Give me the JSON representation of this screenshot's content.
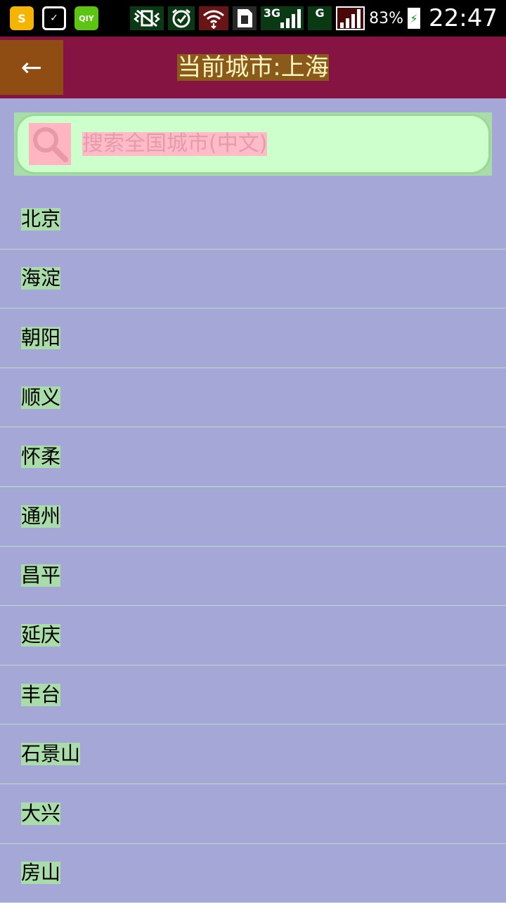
{
  "status_bar": {
    "apps": [
      {
        "name": "sogou-app-icon",
        "glyph": "S"
      },
      {
        "name": "notification-app-icon",
        "glyph": "✓"
      },
      {
        "name": "iqiyi-app-icon",
        "glyph": "QIY"
      }
    ],
    "network_3g": "3G",
    "network_g": "G",
    "battery_percent": "83%",
    "time": "22:47"
  },
  "header": {
    "back_glyph": "←",
    "title": "当前城市:上海"
  },
  "search": {
    "placeholder": "搜索全国城市(中文)"
  },
  "cities": [
    "北京",
    "海淀",
    "朝阳",
    "顺义",
    "怀柔",
    "通州",
    "昌平",
    "延庆",
    "丰台",
    "石景山",
    "大兴",
    "房山"
  ],
  "colors": {
    "title_bar": "#851442",
    "back_button": "#8f4d13",
    "background": "#a5a8d6",
    "search_box": "#ccffcc",
    "city_label_bg": "#a8dca8"
  }
}
